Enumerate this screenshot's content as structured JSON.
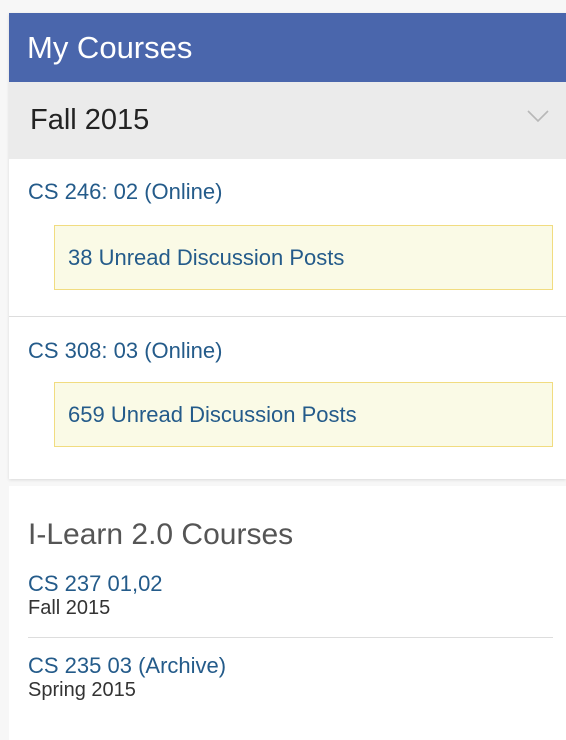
{
  "panel": {
    "title": "My Courses",
    "term": "Fall 2015",
    "courses": [
      {
        "title": "CS 246: 02 (Online)",
        "unread": "38 Unread Discussion Posts"
      },
      {
        "title": "CS 308: 03 (Online)",
        "unread": "659 Unread Discussion Posts"
      }
    ]
  },
  "legacy": {
    "heading": "I-Learn 2.0 Courses",
    "items": [
      {
        "title": "CS 237 01,02",
        "term": "Fall 2015"
      },
      {
        "title": "CS 235 03 (Archive)",
        "term": "Spring 2015"
      }
    ]
  },
  "colors": {
    "header_bg": "#4a66ac",
    "link": "#245b8a",
    "notice_bg": "#fafae6",
    "notice_border": "#f1dc80"
  },
  "icons": {
    "term_toggle": "chevron-down-icon"
  }
}
